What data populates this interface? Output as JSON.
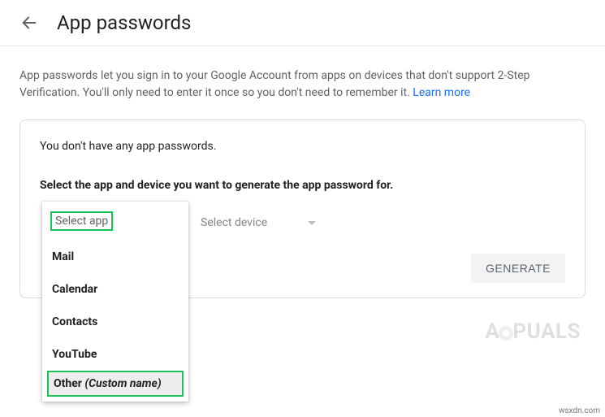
{
  "header": {
    "title": "App passwords"
  },
  "description": {
    "text": "App passwords let you sign in to your Google Account from apps on devices that don't support 2-Step Verification. You'll only need to enter it once so you don't need to remember it. ",
    "learn_more": "Learn more"
  },
  "card": {
    "empty_msg": "You don't have any app passwords.",
    "instruction": "Select the app and device you want to generate the app password for.",
    "device_placeholder": "Select device",
    "generate_label": "GENERATE"
  },
  "dropdown": {
    "header": "Select app",
    "items": [
      "Mail",
      "Calendar",
      "Contacts",
      "YouTube"
    ],
    "other_bold": "Other ",
    "other_italic": "(Custom name)"
  },
  "watermark_left": "A",
  "watermark_right": "PUALS",
  "attribution": "wsxdn.com"
}
